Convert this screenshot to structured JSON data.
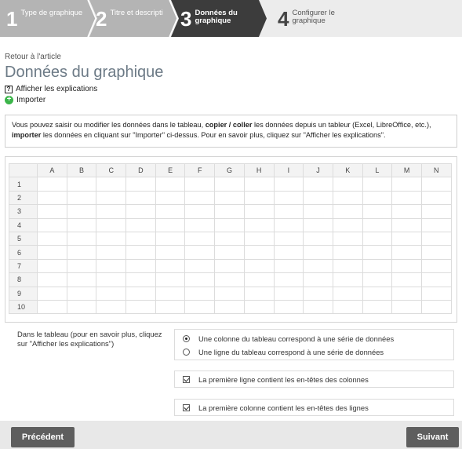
{
  "wizard": {
    "steps": [
      {
        "num": "1",
        "label": "Type de graphique"
      },
      {
        "num": "2",
        "label": "Titre et descripti"
      },
      {
        "num": "3",
        "label_line1": "Données du",
        "label_line2": "graphique"
      },
      {
        "num": "4",
        "label_line1": "Configurer le",
        "label_line2": "graphique"
      }
    ],
    "colors": {
      "done": "#b4b4b4",
      "active": "#3c3c3c",
      "bar": "#ececec"
    }
  },
  "header": {
    "back_link": "Retour à l'article",
    "title": "Données du graphique",
    "help_link": "Afficher les explications",
    "import_link": "Importer"
  },
  "info": {
    "part1": "Vous pouvez saisir ou modifier les données dans le tableau, ",
    "bold1": "copier / coller",
    "part2": " les données depuis un tableur (Excel, LibreOffice, etc.), ",
    "bold2": "importer",
    "part3": " les données en cliquant sur \"Importer\" ci-dessus. Pour en savoir plus, cliquez sur \"Afficher les explications\"."
  },
  "grid": {
    "columns": [
      "A",
      "B",
      "C",
      "D",
      "E",
      "F",
      "G",
      "H",
      "I",
      "J",
      "K",
      "L",
      "M",
      "N"
    ],
    "rows": [
      "1",
      "2",
      "3",
      "4",
      "5",
      "6",
      "7",
      "8",
      "9",
      "10"
    ]
  },
  "options": {
    "description": "Dans le tableau (pour en savoir plus, cliquez sur \"Afficher les explications\")",
    "radio_column": "Une colonne du tableau correspond à une série de données",
    "radio_row": "Une ligne du tableau correspond à une série de données",
    "check_first_row": "La première ligne contient les en-têtes des colonnes",
    "check_first_col": "La première colonne contient les en-têtes des lignes",
    "selected_radio": "column",
    "first_row_checked": true,
    "first_col_checked": true
  },
  "footer": {
    "prev_label": "Précédent",
    "next_label": "Suivant"
  }
}
